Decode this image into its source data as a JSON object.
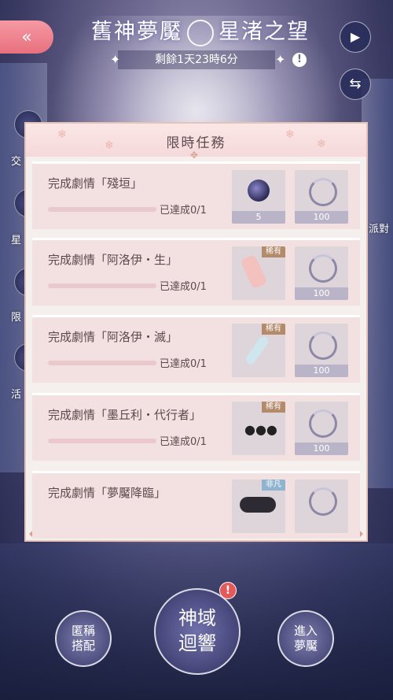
{
  "header": {
    "title_left": "舊神夢魘",
    "title_right": "星渚之望",
    "timer": "剩餘1天23時6分",
    "info_icon": "info-icon",
    "back_icon": "double-chevron-left-icon",
    "play_icon": "play-icon",
    "swap_icon": "swap-arrows-icon"
  },
  "side_labels": {
    "left": [
      "交",
      "星",
      "限",
      "活"
    ],
    "right": "派對"
  },
  "dialog": {
    "title": "限時任務",
    "quests": [
      {
        "title": "完成劇情「殘垣」",
        "progress_text": "已達成0/1",
        "progress": 0,
        "rewards": [
          {
            "icon": "dark-gem-icon",
            "count": "5",
            "rare_label": ""
          },
          {
            "icon": "swirl-token-icon",
            "count": "100",
            "rare_label": ""
          }
        ]
      },
      {
        "title": "完成劇情「阿洛伊・生」",
        "progress_text": "已達成0/1",
        "progress": 0,
        "rewards": [
          {
            "icon": "socks-icon",
            "count": "",
            "rare_label": "稀有"
          },
          {
            "icon": "swirl-token-icon",
            "count": "100",
            "rare_label": ""
          }
        ]
      },
      {
        "title": "完成劇情「阿洛伊・滅」",
        "progress_text": "已達成0/1",
        "progress": 0,
        "rewards": [
          {
            "icon": "crystal-accessory-icon",
            "count": "",
            "rare_label": "稀有"
          },
          {
            "icon": "swirl-token-icon",
            "count": "100",
            "rare_label": ""
          }
        ]
      },
      {
        "title": "完成劇情「墨丘利・代行者」",
        "progress_text": "已達成0/1",
        "progress": 0,
        "rewards": [
          {
            "icon": "earrings-icon",
            "count": "",
            "rare_label": "稀有"
          },
          {
            "icon": "swirl-token-icon",
            "count": "100",
            "rare_label": ""
          }
        ]
      },
      {
        "title": "完成劇情「夢魘降臨」",
        "progress_text": "",
        "progress": 0,
        "rewards": [
          {
            "icon": "eye-mask-icon",
            "count": "",
            "rare_label": "非凡"
          },
          {
            "icon": "swirl-token-icon",
            "count": "",
            "rare_label": ""
          }
        ]
      }
    ]
  },
  "bottom": {
    "left_label": "匿稱搭配",
    "center_label": "神域迴響",
    "right_label": "進入夢魘",
    "alert": "!"
  },
  "colors": {
    "accent_pink": "#e8707e",
    "dialog_bg": "#f5efee",
    "quest_bg": "#f2e1e0",
    "rare_tag": "#b38b6b",
    "alert_red": "#e45a5a"
  }
}
